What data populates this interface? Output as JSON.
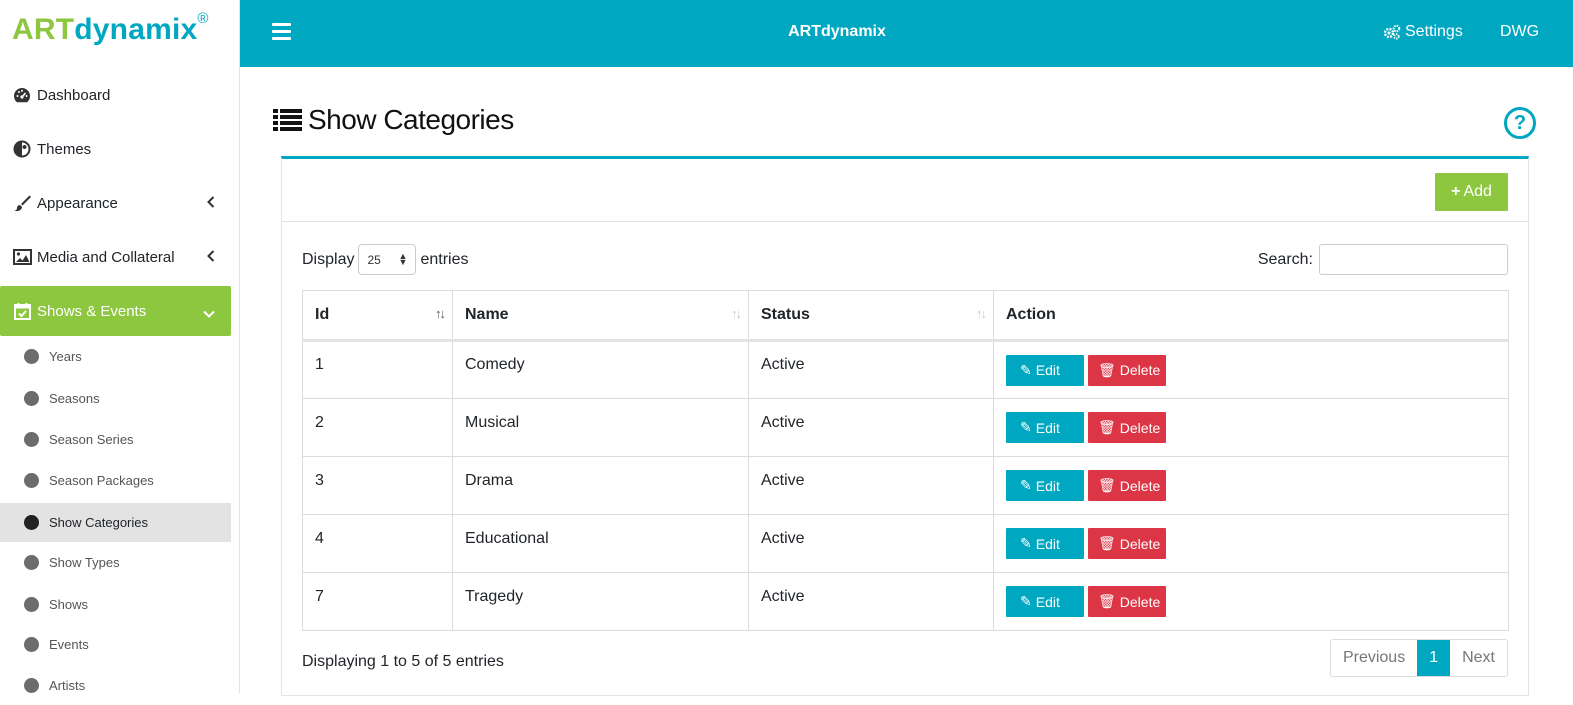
{
  "logo": {
    "part1": "ART",
    "part2": "dynamix",
    "mark": "®"
  },
  "topbar": {
    "title": "ARTdynamix",
    "settings": "Settings",
    "user": "DWG"
  },
  "sidebar": {
    "items": [
      {
        "label": "Dashboard",
        "icon": "dashboard-icon"
      },
      {
        "label": "Themes",
        "icon": "themes-icon"
      },
      {
        "label": "Appearance",
        "icon": "brush-icon"
      },
      {
        "label": "Media and Collateral",
        "icon": "image-icon"
      },
      {
        "label": "Shows & Events",
        "icon": "calendar-check-icon"
      }
    ],
    "subitems": [
      "Years",
      "Seasons",
      "Season Series",
      "Season Packages",
      "Show Categories",
      "Show Types",
      "Shows",
      "Events",
      "Artists"
    ]
  },
  "page": {
    "title": "Show Categories",
    "help": "?",
    "add_label": "Add"
  },
  "table_controls": {
    "display": "Display",
    "length": "25",
    "entries": "entries",
    "search_label": "Search:"
  },
  "table": {
    "headers": [
      "Id",
      "Name",
      "Status",
      "Action"
    ],
    "rows": [
      {
        "id": "1",
        "name": "Comedy",
        "status": "Active"
      },
      {
        "id": "2",
        "name": "Musical",
        "status": "Active"
      },
      {
        "id": "3",
        "name": "Drama",
        "status": "Active"
      },
      {
        "id": "4",
        "name": "Educational",
        "status": "Active"
      },
      {
        "id": "7",
        "name": "Tragedy",
        "status": "Active"
      }
    ],
    "edit_label": "Edit",
    "delete_label": "Delete"
  },
  "footer": {
    "info": "Displaying 1 to 5 of 5 entries",
    "previous": "Previous",
    "page": "1",
    "next": "Next"
  },
  "colors": {
    "accent": "#00a7c0",
    "green": "#8dc63f",
    "danger": "#dc3545"
  }
}
